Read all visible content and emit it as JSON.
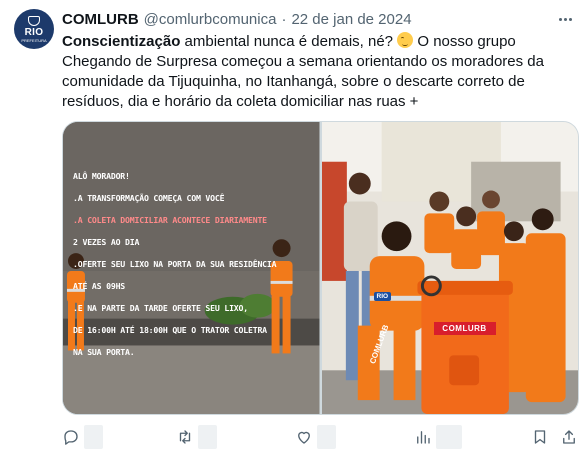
{
  "author": {
    "name": "COMLURB",
    "handle": "@comlurbcomunica",
    "separator": "·",
    "date": "22 de jan de 2024",
    "avatar_text": "RIO",
    "avatar_sub": "PREFEITURA"
  },
  "tweet": {
    "bold_lead": "Conscientização",
    "text_after_lead": " ambiental nunca é demais, né? ",
    "emoji_name": "relieved-face-emoji",
    "text_rest": " O nosso grupo Chegando de Surpresa começou a semana orientando os moradores da comunidade da Tijuquinha, no Itanhangá, sobre o descarte correto de resíduos, dia e horário da coleta domiciliar nas ruas +"
  },
  "media": {
    "photo1": {
      "mural_lines": [
        "ALÔ MORADOR!",
        ".A TRANSFORMAÇÃO COMEÇA COM VOCÊ",
        ".A COLETA DOMICILIAR ACONTECE DIARIAMENTE",
        "2 VEZES AO DIA",
        ".OFERTE SEU LIXO NA PORTA DA SUA RESIDÊNCIA",
        "  ATÉ AS 09HS",
        ".E NA PARTE DA TARDE OFERTE SEU LIXO,",
        " DE 16:00H ATÉ 18:00H QUE O TRATOR COLETRA",
        " NA SUA PORTA."
      ]
    },
    "photo2": {
      "bin_label": "COMLURB",
      "bin_side_text": "COMLURB",
      "vest_badge": "RIO"
    }
  },
  "actions": {
    "reply_icon": "reply-icon",
    "retweet_icon": "retweet-icon",
    "like_icon": "heart-icon",
    "views_icon": "views-icon",
    "bookmark_icon": "bookmark-icon",
    "share_icon": "share-icon"
  },
  "colors": {
    "text": "#0f1419",
    "muted": "#536471",
    "comlurb_orange": "#f27a1a",
    "comlurb_red": "#d81e2c",
    "avatar_blue": "#1d3a6b"
  }
}
